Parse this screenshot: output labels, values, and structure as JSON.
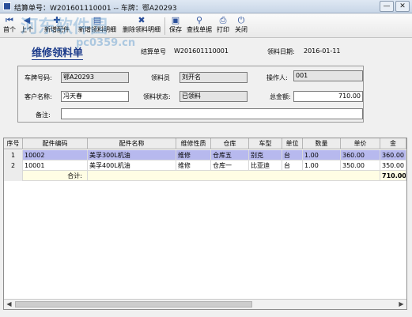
{
  "window": {
    "title": "结算单号：W201601110001 -- 车牌：鄂A20293",
    "minimize_label": "—",
    "close_label": "✕"
  },
  "watermark": {
    "text": "河东软件园",
    "url": "pc0359.cn"
  },
  "toolbar": {
    "items": [
      {
        "label": "首个",
        "icon": "first-record-icon"
      },
      {
        "label": "上个",
        "icon": "previous-record-icon"
      },
      {
        "label": "新增配件",
        "icon": "add-part-icon"
      },
      {
        "label": "新增领料明细",
        "icon": "add-material-detail-icon"
      },
      {
        "label": "删除领料明细",
        "icon": "delete-material-detail-icon"
      },
      {
        "label": "保存",
        "icon": "save-icon"
      },
      {
        "label": "查找单据",
        "icon": "binoculars-icon"
      },
      {
        "label": "打印",
        "icon": "printer-icon"
      },
      {
        "label": "关闭",
        "icon": "close-icon"
      }
    ]
  },
  "form": {
    "title": "维修领料单",
    "settlement_label": "结算单号",
    "settlement_value": "W201601110001",
    "date_label": "领料日期:",
    "date_value": "2016-01-11",
    "plate_label": "车牌号码:",
    "plate_value": "鄂A20293",
    "picker_label": "领料员",
    "picker_value": "刘开名",
    "operator_label": "操作人:",
    "operator_value": "001",
    "customer_label": "客户名称:",
    "customer_value": "冯天春",
    "status_label": "领料状态:",
    "status_value": "已领料",
    "total_label": "总金额:",
    "total_value": "710.00",
    "note_label": "备注:",
    "note_value": ""
  },
  "grid": {
    "columns": [
      "序号",
      "配件编码",
      "配件名称",
      "维修性质",
      "仓库",
      "车型",
      "单位",
      "数量",
      "单价",
      "金"
    ],
    "rows": [
      {
        "no": "1",
        "code": "10002",
        "name": "美孚300L机油",
        "nature": "维修",
        "warehouse": "仓库五",
        "model": "别克",
        "unit": "台",
        "qty": "1.00",
        "price": "360.00",
        "amount": "360.00"
      },
      {
        "no": "2",
        "code": "10001",
        "name": "美孚400L机油",
        "nature": "维修",
        "warehouse": "仓库一",
        "model": "比亚迪",
        "unit": "台",
        "qty": "1.00",
        "price": "350.00",
        "amount": "350.00"
      }
    ],
    "total_row": {
      "label": "合计:",
      "amount": "710.00"
    }
  },
  "scrollbar": {
    "left_arrow": "◀",
    "right_arrow": "▶"
  }
}
